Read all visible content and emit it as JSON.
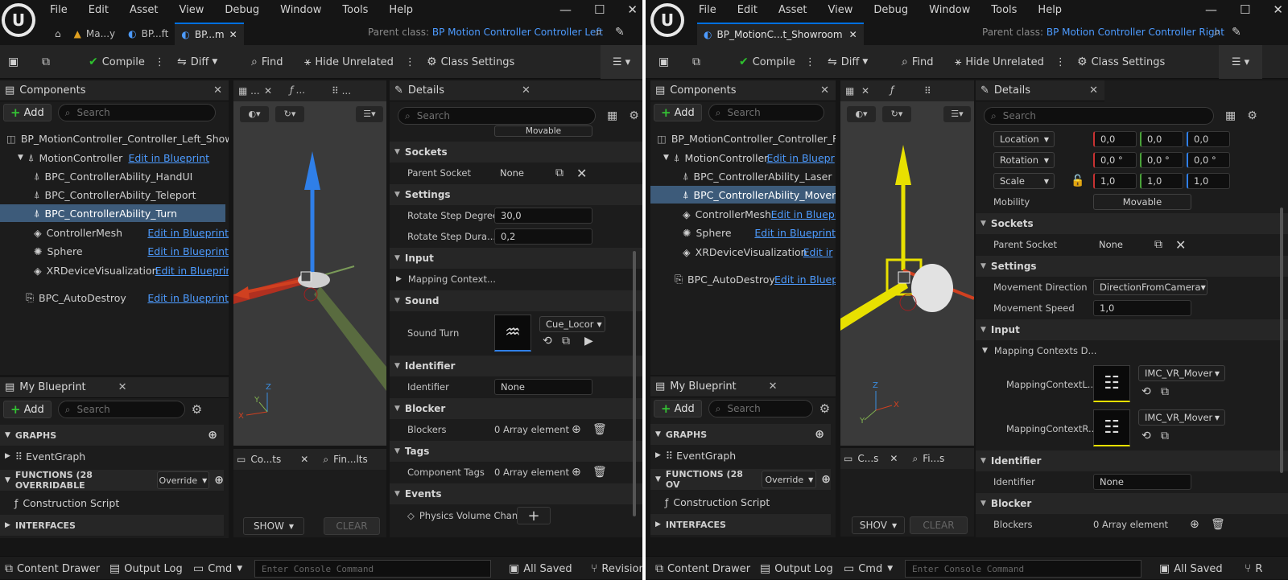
{
  "menu": [
    "File",
    "Edit",
    "Asset",
    "View",
    "Debug",
    "Window",
    "Tools",
    "Help"
  ],
  "left": {
    "tabs": [
      "Ma...y",
      "BP...ft",
      "BP...m"
    ],
    "parent_label": "Parent class:",
    "parent_value": "BP Motion Controller Controller Left",
    "toolbar": {
      "compile": "Compile",
      "diff": "Diff",
      "find": "Find",
      "hide": "Hide Unrelated",
      "settings": "Class Settings"
    },
    "components": {
      "title": "Components",
      "add": "Add",
      "search": "Search",
      "items": [
        {
          "name": "BP_MotionController_Controller_Left_Showro",
          "link": ""
        },
        {
          "name": "MotionController",
          "link": "Edit in Blueprint"
        },
        {
          "name": "BPC_ControllerAbility_HandUI",
          "link": ""
        },
        {
          "name": "BPC_ControllerAbility_Teleport",
          "link": ""
        },
        {
          "name": "BPC_ControllerAbility_Turn",
          "link": ""
        },
        {
          "name": "ControllerMesh",
          "link": "Edit in Blueprint"
        },
        {
          "name": "Sphere",
          "link": "Edit in Blueprint"
        },
        {
          "name": "XRDeviceVisualization",
          "link": "Edit in Blueprin"
        },
        {
          "name": "BPC_AutoDestroy",
          "link": "Edit in Blueprint"
        }
      ]
    },
    "myblueprint": {
      "title": "My Blueprint",
      "add": "Add",
      "search": "Search",
      "graphs": "GRAPHS",
      "eventgraph": "EventGraph",
      "functions": "FUNCTIONS (28 OVERRIDABLE",
      "override": "Override",
      "construction": "Construction Script",
      "interfaces": "INTERFACES"
    },
    "bottom_tabs": [
      "Co...ts",
      "Fin...lts"
    ],
    "show": "SHOW",
    "clear": "CLEAR",
    "details": {
      "title": "Details",
      "search": "Search",
      "mobility_value": "Movable",
      "sockets": "Sockets",
      "parent_socket": "Parent Socket",
      "parent_socket_value": "None",
      "settings": "Settings",
      "rotate_step_degree": "Rotate Step Degree",
      "rotate_step_degree_value": "30,0",
      "rotate_step_dura": "Rotate Step Dura...",
      "rotate_step_dura_value": "0,2",
      "input": "Input",
      "mapping_context": "Mapping Context...",
      "sound": "Sound",
      "sound_turn": "Sound Turn",
      "sound_asset": "Cue_Locor",
      "identifier_sec": "Identifier",
      "identifier": "Identifier",
      "identifier_value": "None",
      "blocker": "Blocker",
      "blockers": "Blockers",
      "blockers_value": "0 Array element",
      "tags": "Tags",
      "component_tags": "Component Tags",
      "component_tags_value": "0 Array element",
      "events": "Events",
      "physics": "Physics Volume Change"
    },
    "status": {
      "drawer": "Content Drawer",
      "output": "Output Log",
      "cmd": "Cmd",
      "console": "Enter Console Command",
      "saved": "All Saved",
      "revision": "Revision"
    }
  },
  "right": {
    "tab": "BP_MotionC...t_Showroom",
    "parent_label": "Parent class:",
    "parent_value": "BP Motion Controller Controller Right",
    "toolbar": {
      "compile": "Compile",
      "diff": "Diff",
      "find": "Find",
      "hide": "Hide Unrelated",
      "settings": "Class Settings"
    },
    "components": {
      "title": "Components",
      "add": "Add",
      "search": "Search",
      "items": [
        {
          "name": "BP_MotionController_Controller_Rig",
          "link": ""
        },
        {
          "name": "MotionController",
          "link": "Edit in Bluepr"
        },
        {
          "name": "BPC_ControllerAbility_Laser",
          "link": ""
        },
        {
          "name": "BPC_ControllerAbility_Movem",
          "link": ""
        },
        {
          "name": "ControllerMesh",
          "link": "Edit in Bluepr"
        },
        {
          "name": "Sphere",
          "link": "Edit in Blueprint"
        },
        {
          "name": "XRDeviceVisualization",
          "link": "Edit ir"
        },
        {
          "name": "BPC_AutoDestroy",
          "link": "Edit in Bluep"
        }
      ]
    },
    "myblueprint": {
      "title": "My Blueprint",
      "add": "Add",
      "search": "Search",
      "graphs": "GRAPHS",
      "eventgraph": "EventGraph",
      "functions": "FUNCTIONS (28 OV",
      "override": "Override",
      "construction": "Construction Script",
      "interfaces": "INTERFACES"
    },
    "bottom_tabs": [
      "C...s",
      "Fi...s"
    ],
    "show": "SHOV",
    "clear": "CLEAR",
    "details": {
      "title": "Details",
      "search": "Search",
      "location": "Location",
      "rotation": "Rotation",
      "scale": "Scale",
      "loc": [
        "0,0",
        "0,0",
        "0,0"
      ],
      "rot": [
        "0,0 °",
        "0,0 °",
        "0,0 °"
      ],
      "scl": [
        "1,0",
        "1,0",
        "1,0"
      ],
      "mobility": "Mobility",
      "mobility_value": "Movable",
      "sockets": "Sockets",
      "parent_socket": "Parent Socket",
      "parent_socket_value": "None",
      "settings": "Settings",
      "movement_direction": "Movement Direction",
      "movement_direction_value": "DirectionFromCamera",
      "movement_speed": "Movement Speed",
      "movement_speed_value": "1,0",
      "input": "Input",
      "mapping_contexts": "Mapping Contexts D...",
      "mapping_l": "MappingContextL...",
      "mapping_r": "MappingContextR...",
      "imc_l": "IMC_VR_Mover",
      "imc_r": "IMC_VR_Mover",
      "identifier_sec": "Identifier",
      "identifier": "Identifier",
      "identifier_value": "None",
      "blocker": "Blocker",
      "blockers": "Blockers",
      "blockers_value": "0 Array element"
    },
    "status": {
      "drawer": "Content Drawer",
      "output": "Output Log",
      "cmd": "Cmd",
      "console": "Enter Console Command",
      "saved": "All Saved",
      "revision": "R"
    }
  },
  "colors": {
    "accent": "#0070e0",
    "link": "#4d9bff",
    "selected": "#3d5b7a",
    "compile_ok": "#2ec22e"
  }
}
